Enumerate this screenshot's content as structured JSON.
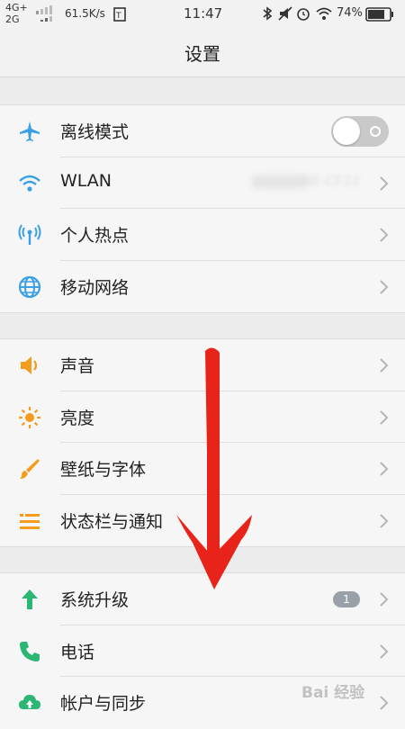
{
  "status_bar": {
    "network_top": "4G+",
    "network_bottom": "2G",
    "speed": "61.5K/s",
    "time": "11:47",
    "battery": "74%"
  },
  "header": {
    "title": "设置"
  },
  "groups": [
    {
      "items": [
        {
          "label": "离线模式",
          "icon": "airplane-icon",
          "color": "#3aa0e6",
          "control": "toggle",
          "toggle_on": false
        },
        {
          "label": "WLAN",
          "icon": "wifi-icon",
          "color": "#3aa0e6",
          "value": "NE-CF22"
        },
        {
          "label": "个人热点",
          "icon": "hotspot-icon",
          "color": "#3aa0e6"
        },
        {
          "label": "移动网络",
          "icon": "globe-icon",
          "color": "#3aa0e6"
        }
      ]
    },
    {
      "items": [
        {
          "label": "声音",
          "icon": "speaker-icon",
          "color": "#f39c1e"
        },
        {
          "label": "亮度",
          "icon": "brightness-icon",
          "color": "#f39c1e"
        },
        {
          "label": "壁纸与字体",
          "icon": "brush-icon",
          "color": "#f39c1e"
        },
        {
          "label": "状态栏与通知",
          "icon": "menu-lines-icon",
          "color": "#f39c1e"
        }
      ]
    },
    {
      "items": [
        {
          "label": "系统升级",
          "icon": "upgrade-arrow-icon",
          "color": "#2bb673",
          "badge": "1"
        },
        {
          "label": "电话",
          "icon": "phone-icon",
          "color": "#2bb673"
        },
        {
          "label": "帐户与同步",
          "icon": "cloud-sync-icon",
          "color": "#2bb673"
        }
      ]
    }
  ],
  "watermark": "Bai 经验"
}
